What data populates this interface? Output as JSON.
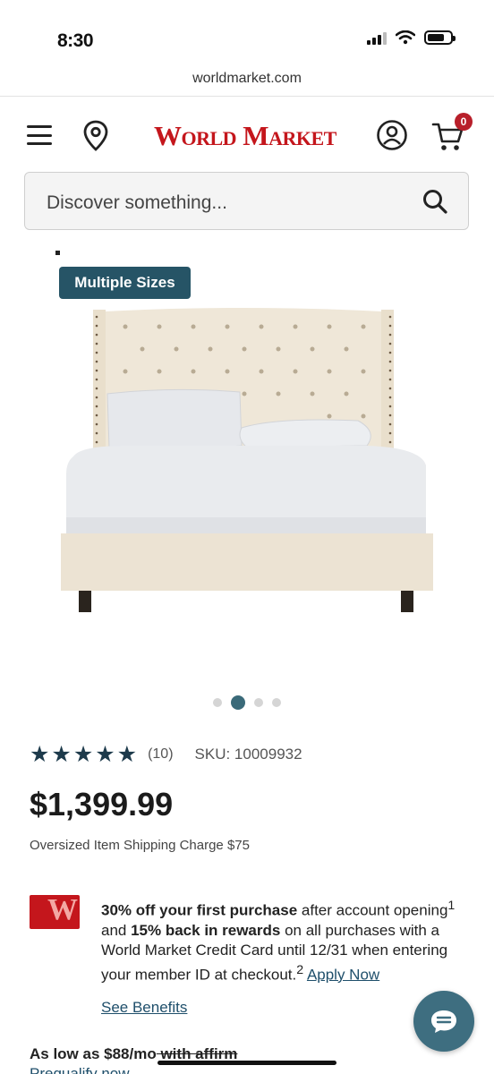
{
  "status_bar": {
    "time": "8:30"
  },
  "browser": {
    "url": "worldmarket.com"
  },
  "header": {
    "logo_text": "World Market",
    "cart_count": "0",
    "icons": [
      "menu-icon",
      "location-pin-icon",
      "account-icon",
      "cart-icon"
    ]
  },
  "search": {
    "placeholder": "Discover something..."
  },
  "product": {
    "badge": "Multiple Sizes",
    "stars": "★★★★★",
    "review_count": "(10)",
    "sku": "SKU: 10009932",
    "price": "$1,399.99",
    "shipping_note": "Oversized Item Shipping Charge $75",
    "carousel": {
      "total": 4,
      "active_index": 1
    }
  },
  "promo": {
    "bold_1": "30% off your first purchase",
    "text_1": " after account opening",
    "sup_1": "1",
    "text_2": " and ",
    "bold_2": "15% back in rewards",
    "text_3": " on all purchases with a World Market Credit Card until 12/31 when entering your member ID at checkout.",
    "sup_2": "2",
    "apply_link": "Apply Now",
    "see_benefits": "See Benefits"
  },
  "financing": {
    "prefix": "As low as $88/mo",
    "suffix": " with affirm",
    "prequalify": "Prequalify now"
  },
  "colors": {
    "brand_red": "#c4161c",
    "badge_teal": "#265466",
    "star_navy": "#1d3a4b",
    "link_blue": "#1f4f6b",
    "chat_teal": "#3e6e80"
  }
}
